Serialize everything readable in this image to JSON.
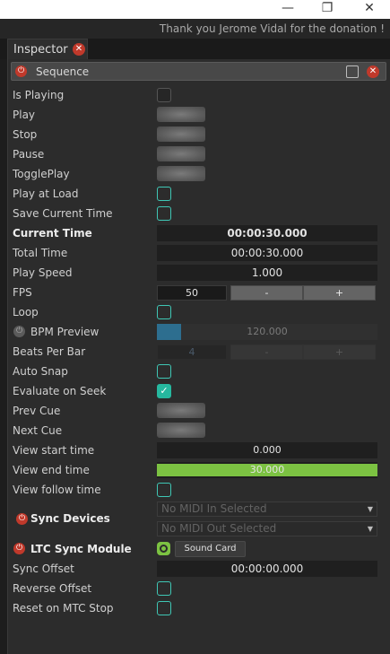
{
  "window": {
    "minimize": "—",
    "maximize": "❐",
    "close": "✕"
  },
  "notice": "Thank you Jerome Vidal for the donation !",
  "tab": {
    "label": "Inspector",
    "close": "✕"
  },
  "section": {
    "title": "Sequence"
  },
  "rows": {
    "is_playing": "Is Playing",
    "play": "Play",
    "stop": "Stop",
    "pause": "Pause",
    "toggleplay": "TogglePlay",
    "play_at_load": "Play at Load",
    "save_current_time": "Save Current Time",
    "current_time": "Current Time",
    "total_time": "Total Time",
    "play_speed": "Play Speed",
    "fps": "FPS",
    "loop": "Loop",
    "bpm_preview": "BPM Preview",
    "beats_per_bar": "Beats Per Bar",
    "auto_snap": "Auto Snap",
    "evaluate_on_seek": "Evaluate on Seek",
    "prev_cue": "Prev Cue",
    "next_cue": "Next Cue",
    "view_start_time": "View start time",
    "view_end_time": "View end time",
    "view_follow_time": "View follow time",
    "sync_devices": "Sync Devices",
    "ltc_sync_module": "LTC Sync Module",
    "sync_offset": "Sync Offset",
    "reverse_offset": "Reverse Offset",
    "reset_on_mtc_stop": "Reset on MTC Stop"
  },
  "values": {
    "current_time": "00:00:30.000",
    "total_time": "00:00:30.000",
    "play_speed": "1.000",
    "fps": "50",
    "fps_minus": "-",
    "fps_plus": "+",
    "bpm": "120.000",
    "bpm_fill_fraction": 0.11,
    "beats_per_bar": "4",
    "beats_minus": "-",
    "beats_plus": "+",
    "view_start_time": "0.000",
    "view_end_time": "30.000",
    "view_end_fill_fraction": 1.0,
    "midi_in": "No MIDI In Selected",
    "midi_out": "No MIDI Out Selected",
    "ltc_device": "Sound Card",
    "sync_offset": "00:00:00.000",
    "evaluate_on_seek_checked": true
  },
  "icons": {
    "power": "⏻",
    "check": "✓",
    "dropdown": "▼"
  },
  "colors": {
    "accent_teal": "#3fc7b5",
    "power_red": "#c0392b",
    "view_green": "#7cc242",
    "bpm_blue": "#2d6e8f"
  }
}
